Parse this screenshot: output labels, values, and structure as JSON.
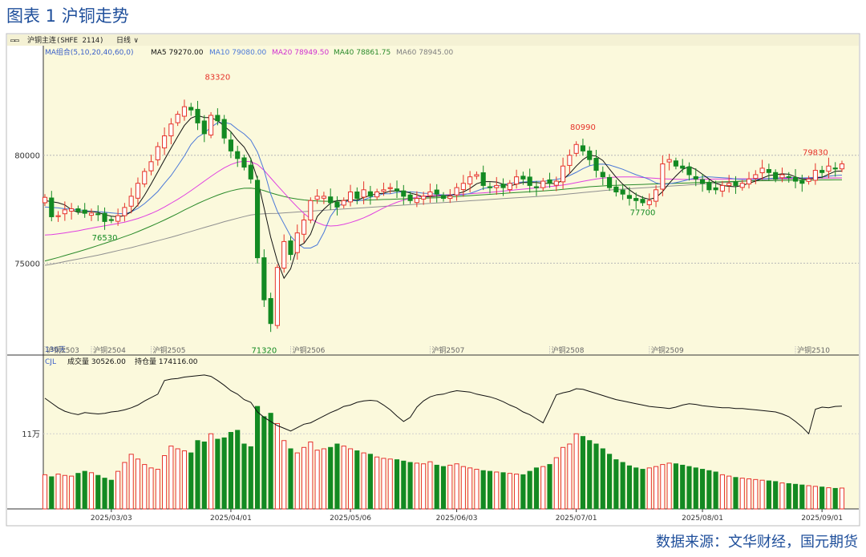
{
  "figure_title": "图表 1 沪铜走势",
  "source": "数据来源：文华财经，国元期货",
  "toolbar": {
    "symbol": "沪铜主连(SHFE 2114)",
    "period": "日线",
    "ma_group": "MA组合(5,10,20,40,60,0)",
    "ma5": "MA5 79270.00",
    "ma10": "MA10 79080.00",
    "ma20": "MA20 78949.50",
    "ma40": "MA40 78861.75",
    "ma60": "MA60 78945.00"
  },
  "volume_header": {
    "indicator": "CJL",
    "volume": "成交量 30526.00",
    "open_interest": "持仓量 174116.00"
  },
  "colors": {
    "panel_bg": "#fbf9dc",
    "up": "#e6332a",
    "down": "#138a22",
    "ma5": "#111111",
    "ma10": "#4a78d8",
    "ma20": "#e040e0",
    "ma40": "#2a8a2a",
    "ma60": "#909090"
  },
  "chart_data": {
    "type": "candlestick",
    "price_axis": {
      "ylim": [
        71000,
        84300
      ],
      "ticks": [
        75000,
        80000
      ]
    },
    "volume_axis": {
      "ylim": [
        0,
        210000
      ],
      "ticks": [
        {
          "value": 110000,
          "label": "11万"
        }
      ]
    },
    "date_labels": [
      "2025/03/03",
      "2025/04/01",
      "2025/05/06",
      "2025/06/03",
      "2025/07/01",
      "2025/08/01",
      "2025/09/01"
    ],
    "date_label_index": [
      10,
      28,
      46,
      62,
      80,
      99,
      117
    ],
    "contract_labels": [
      "沪铜2503",
      "沪铜2504",
      "沪铜2505",
      "沪铜2506",
      "沪铜2507",
      "沪铜2508",
      "沪铜2509",
      "沪铜2510"
    ],
    "contract_label_index": [
      0,
      7,
      16,
      37,
      58,
      76,
      91,
      113
    ],
    "price_annotations": [
      {
        "index": 26,
        "value": 83320,
        "text": "83320",
        "position": "above"
      },
      {
        "index": 9,
        "value": 76530,
        "text": "76530",
        "position": "below"
      },
      {
        "index": 33,
        "value": 71320,
        "text": "71320",
        "position": "below"
      },
      {
        "index": 81,
        "value": 80990,
        "text": "80990",
        "position": "above"
      },
      {
        "index": 90,
        "value": 77700,
        "text": "77700",
        "position": "below"
      },
      {
        "index": 116,
        "value": 79830,
        "text": "79830",
        "position": "above"
      }
    ],
    "annotation_colors": {
      "above": "#e6332a",
      "below": "#138a22"
    },
    "lower_left_label": "136天",
    "close": [
      78050,
      77150,
      77200,
      77470,
      77520,
      77400,
      77310,
      77320,
      77280,
      76930,
      77000,
      77200,
      77580,
      78100,
      78700,
      79250,
      79700,
      80400,
      80900,
      81450,
      81900,
      82250,
      82100,
      81500,
      81000,
      81850,
      81600,
      80800,
      80200,
      79850,
      79450,
      78900,
      75250,
      73300,
      72200,
      74800,
      76000,
      75400,
      76400,
      77000,
      77900,
      78100,
      78100,
      77800,
      77600,
      77900,
      78300,
      78000,
      78400,
      78100,
      78300,
      78400,
      78500,
      78350,
      78100,
      77900,
      78000,
      78100,
      78300,
      78200,
      78000,
      78100,
      78500,
      78700,
      79000,
      79100,
      78600,
      78500,
      78600,
      78500,
      78700,
      79000,
      78900,
      78600,
      78500,
      78800,
      78700,
      78800,
      79500,
      80000,
      80500,
      80200,
      79800,
      79300,
      79000,
      78500,
      78300,
      78200,
      78000,
      77900,
      77800,
      77900,
      78400,
      79600,
      79800,
      79500,
      79400,
      79100,
      78900,
      78700,
      78400,
      78400,
      78600,
      78700,
      78600,
      78700,
      78900,
      79100,
      79400,
      79200,
      78900,
      79100,
      79000,
      78800,
      78700,
      78900,
      79300,
      79200,
      79500,
      79400,
      79600
    ],
    "volume": [
      50000,
      47000,
      51000,
      49000,
      48000,
      52000,
      55000,
      53000,
      49000,
      45000,
      42000,
      55000,
      68000,
      80000,
      73000,
      65000,
      60000,
      58000,
      78000,
      92000,
      88000,
      85000,
      82000,
      100000,
      98000,
      110000,
      102000,
      104000,
      112000,
      115000,
      95000,
      91000,
      150000,
      135000,
      140000,
      125000,
      100000,
      88000,
      82000,
      90000,
      98000,
      86000,
      88000,
      90000,
      95000,
      92000,
      88000,
      85000,
      82000,
      80000,
      76000,
      74000,
      73000,
      72000,
      70000,
      68000,
      67000,
      66000,
      69000,
      64000,
      62000,
      64000,
      66000,
      62000,
      60000,
      58000,
      56000,
      55000,
      54000,
      53000,
      52000,
      51000,
      50000,
      55000,
      60000,
      62000,
      65000,
      75000,
      90000,
      95000,
      110000,
      106000,
      100000,
      95000,
      88000,
      80000,
      72000,
      68000,
      63000,
      60000,
      58000,
      60000,
      62000,
      65000,
      67000,
      66000,
      64000,
      62000,
      60000,
      58000,
      56000,
      54000,
      50000,
      48000,
      46000,
      45000,
      44000,
      43000,
      42000,
      41000,
      40000,
      38000,
      37000,
      36000,
      35000,
      34000,
      33000,
      32000,
      31000,
      30000,
      30526
    ],
    "open_interest": [
      162000,
      155000,
      148000,
      143000,
      140000,
      138000,
      141000,
      140000,
      139000,
      140000,
      142000,
      143000,
      145000,
      148000,
      152000,
      158000,
      163000,
      168000,
      188000,
      190000,
      191000,
      193000,
      194000,
      195000,
      196000,
      194000,
      188000,
      181000,
      173000,
      168000,
      160000,
      156000,
      142000,
      134000,
      128000,
      122000,
      118000,
      114000,
      119000,
      124000,
      126000,
      131000,
      136000,
      141000,
      145000,
      150000,
      152000,
      156000,
      158000,
      159000,
      158000,
      152000,
      145000,
      136000,
      128000,
      134000,
      149000,
      158000,
      164000,
      167000,
      168000,
      171000,
      173000,
      172000,
      171000,
      168000,
      166000,
      164000,
      161000,
      157000,
      152000,
      148000,
      142000,
      138000,
      132000,
      126000,
      146000,
      167000,
      170000,
      172000,
      176000,
      175000,
      172000,
      169000,
      166000,
      163000,
      160000,
      158000,
      156000,
      154000,
      152000,
      150000,
      149000,
      148000,
      147000,
      149000,
      152000,
      154000,
      153000,
      151000,
      150000,
      149000,
      148000,
      148000,
      147000,
      147000,
      146000,
      145000,
      144000,
      143000,
      142000,
      139000,
      135000,
      128000,
      120000,
      110000,
      146000,
      149000,
      148000,
      150000,
      150500
    ],
    "ma5": [
      77900,
      77850,
      77800,
      77700,
      77480,
      77350,
      77380,
      77400,
      77350,
      77250,
      77180,
      77150,
      77200,
      77380,
      77700,
      78150,
      78670,
      79230,
      79790,
      80340,
      80870,
      81380,
      81720,
      81840,
      81750,
      81740,
      81610,
      81350,
      81090,
      80700,
      80380,
      79840,
      78900,
      77550,
      76200,
      75090,
      74300,
      74740,
      75760,
      75920,
      76340,
      77160,
      77500,
      77780,
      77900,
      77900,
      77940,
      77920,
      78040,
      78140,
      78220,
      78240,
      78340,
      78350,
      78330,
      78250,
      78170,
      78070,
      78080,
      78100,
      78120,
      78140,
      78220,
      78300,
      78460,
      78680,
      78780,
      78780,
      78760,
      78660,
      78580,
      78660,
      78740,
      78740,
      78740,
      78700,
      78700,
      78680,
      78860,
      79160,
      79500,
      79800,
      80000,
      79960,
      79760,
      79360,
      78980,
      78660,
      78400,
      78180,
      78040,
      77960,
      78040,
      78320,
      78700,
      79040,
      79340,
      79480,
      79340,
      79120,
      78900,
      78700,
      78600,
      78560,
      78540,
      78600,
      78700,
      78800,
      78940,
      79060,
      79100,
      79140,
      79120,
      79000,
      78900,
      78900,
      78940,
      78980,
      79120,
      79260,
      79270
    ],
    "ma10": [
      77600,
      77580,
      77560,
      77520,
      77500,
      77470,
      77430,
      77400,
      77390,
      77360,
      77330,
      77300,
      77290,
      77380,
      77540,
      77760,
      78030,
      78320,
      78700,
      79060,
      79510,
      79970,
      80500,
      80840,
      81030,
      81300,
      81510,
      81530,
      81450,
      81200,
      80990,
      80700,
      80150,
      79300,
      78200,
      77400,
      76820,
      76250,
      75920,
      75700,
      75700,
      75850,
      76420,
      77170,
      77600,
      77800,
      77930,
      77880,
      77930,
      78050,
      78120,
      78220,
      78220,
      78280,
      78290,
      78310,
      78280,
      78240,
      78230,
      78200,
      78160,
      78150,
      78150,
      78170,
      78230,
      78340,
      78460,
      78520,
      78580,
      78640,
      78700,
      78740,
      78760,
      78780,
      78790,
      78790,
      78830,
      78880,
      78940,
      79060,
      79210,
      79380,
      79510,
      79580,
      79590,
      79550,
      79450,
      79350,
      79220,
      79100,
      79000,
      78880,
      78720,
      78650,
      78680,
      78730,
      78800,
      78880,
      78950,
      79000,
      79000,
      78980,
      78960,
      78940,
      78900,
      78880,
      78880,
      78880,
      78900,
      78920,
      78940,
      78960,
      78980,
      78960,
      78950,
      78960,
      78980,
      79000,
      79030,
      79060,
      79080
    ],
    "ma20": [
      76300,
      76320,
      76360,
      76400,
      76450,
      76500,
      76560,
      76620,
      76680,
      76730,
      76780,
      76840,
      76900,
      76980,
      77070,
      77180,
      77300,
      77440,
      77600,
      77780,
      77960,
      78150,
      78360,
      78580,
      78800,
      79020,
      79230,
      79420,
      79570,
      79680,
      79720,
      79700,
      79570,
      79300,
      78950,
      78600,
      78260,
      77920,
      77600,
      77300,
      77060,
      76880,
      76760,
      76720,
      76740,
      76800,
      76880,
      76980,
      77100,
      77240,
      77400,
      77560,
      77700,
      77820,
      77920,
      78000,
      78060,
      78100,
      78130,
      78150,
      78160,
      78170,
      78180,
      78200,
      78220,
      78240,
      78260,
      78280,
      78310,
      78340,
      78370,
      78400,
      78430,
      78460,
      78490,
      78520,
      78550,
      78580,
      78620,
      78670,
      78730,
      78790,
      78850,
      78900,
      78940,
      78970,
      78990,
      79000,
      79000,
      78990,
      78970,
      78950,
      78930,
      78910,
      78900,
      78890,
      78880,
      78880,
      78880,
      78890,
      78890,
      78900,
      78900,
      78900,
      78910,
      78910,
      78910,
      78920,
      78920,
      78920,
      78930,
      78930,
      78930,
      78940,
      78940,
      78940,
      78945,
      78945,
      78948,
      78949,
      78949.5
    ],
    "ma40": [
      75100,
      75180,
      75260,
      75350,
      75440,
      75530,
      75620,
      75720,
      75820,
      75920,
      76020,
      76120,
      76230,
      76340,
      76460,
      76590,
      76720,
      76860,
      77000,
      77150,
      77300,
      77460,
      77610,
      77760,
      77900,
      78030,
      78150,
      78260,
      78350,
      78420,
      78470,
      78480,
      78440,
      78360,
      78260,
      78170,
      78090,
      78020,
      77970,
      77930,
      77900,
      77880,
      77870,
      77870,
      77880,
      77890,
      77900,
      77910,
      77920,
      77930,
      77940,
      77950,
      77960,
      77970,
      77980,
      77990,
      78000,
      78010,
      78020,
      78030,
      78050,
      78070,
      78090,
      78110,
      78130,
      78150,
      78170,
      78190,
      78210,
      78230,
      78250,
      78270,
      78290,
      78310,
      78330,
      78350,
      78370,
      78390,
      78420,
      78450,
      78480,
      78510,
      78540,
      78560,
      78580,
      78600,
      78610,
      78620,
      78630,
      78640,
      78650,
      78660,
      78670,
      78680,
      78690,
      78700,
      78710,
      78720,
      78730,
      78740,
      78750,
      78760,
      78770,
      78780,
      78790,
      78800,
      78810,
      78815,
      78820,
      78825,
      78830,
      78835,
      78840,
      78845,
      78848,
      78851,
      78854,
      78857,
      78859,
      78860,
      78861.75
    ],
    "ma60": [
      74900,
      74950,
      75010,
      75070,
      75130,
      75190,
      75250,
      75310,
      75370,
      75440,
      75510,
      75580,
      75650,
      75720,
      75800,
      75880,
      75960,
      76040,
      76120,
      76200,
      76290,
      76380,
      76470,
      76560,
      76650,
      76740,
      76830,
      76920,
      77000,
      77080,
      77160,
      77230,
      77270,
      77290,
      77300,
      77310,
      77330,
      77350,
      77370,
      77390,
      77410,
      77430,
      77450,
      77470,
      77490,
      77510,
      77530,
      77550,
      77570,
      77590,
      77610,
      77630,
      77650,
      77670,
      77690,
      77710,
      77730,
      77750,
      77770,
      77790,
      77810,
      77830,
      77850,
      77870,
      77890,
      77910,
      77930,
      77950,
      77970,
      77990,
      78010,
      78030,
      78050,
      78070,
      78090,
      78110,
      78130,
      78150,
      78180,
      78210,
      78240,
      78270,
      78300,
      78330,
      78360,
      78390,
      78410,
      78430,
      78450,
      78470,
      78490,
      78510,
      78530,
      78550,
      78570,
      78590,
      78610,
      78630,
      78650,
      78670,
      78690,
      78710,
      78730,
      78750,
      78770,
      78790,
      78810,
      78830,
      78850,
      78870,
      78880,
      78890,
      78900,
      78910,
      78920,
      78925,
      78930,
      78935,
      78940,
      78943,
      78945
    ]
  }
}
